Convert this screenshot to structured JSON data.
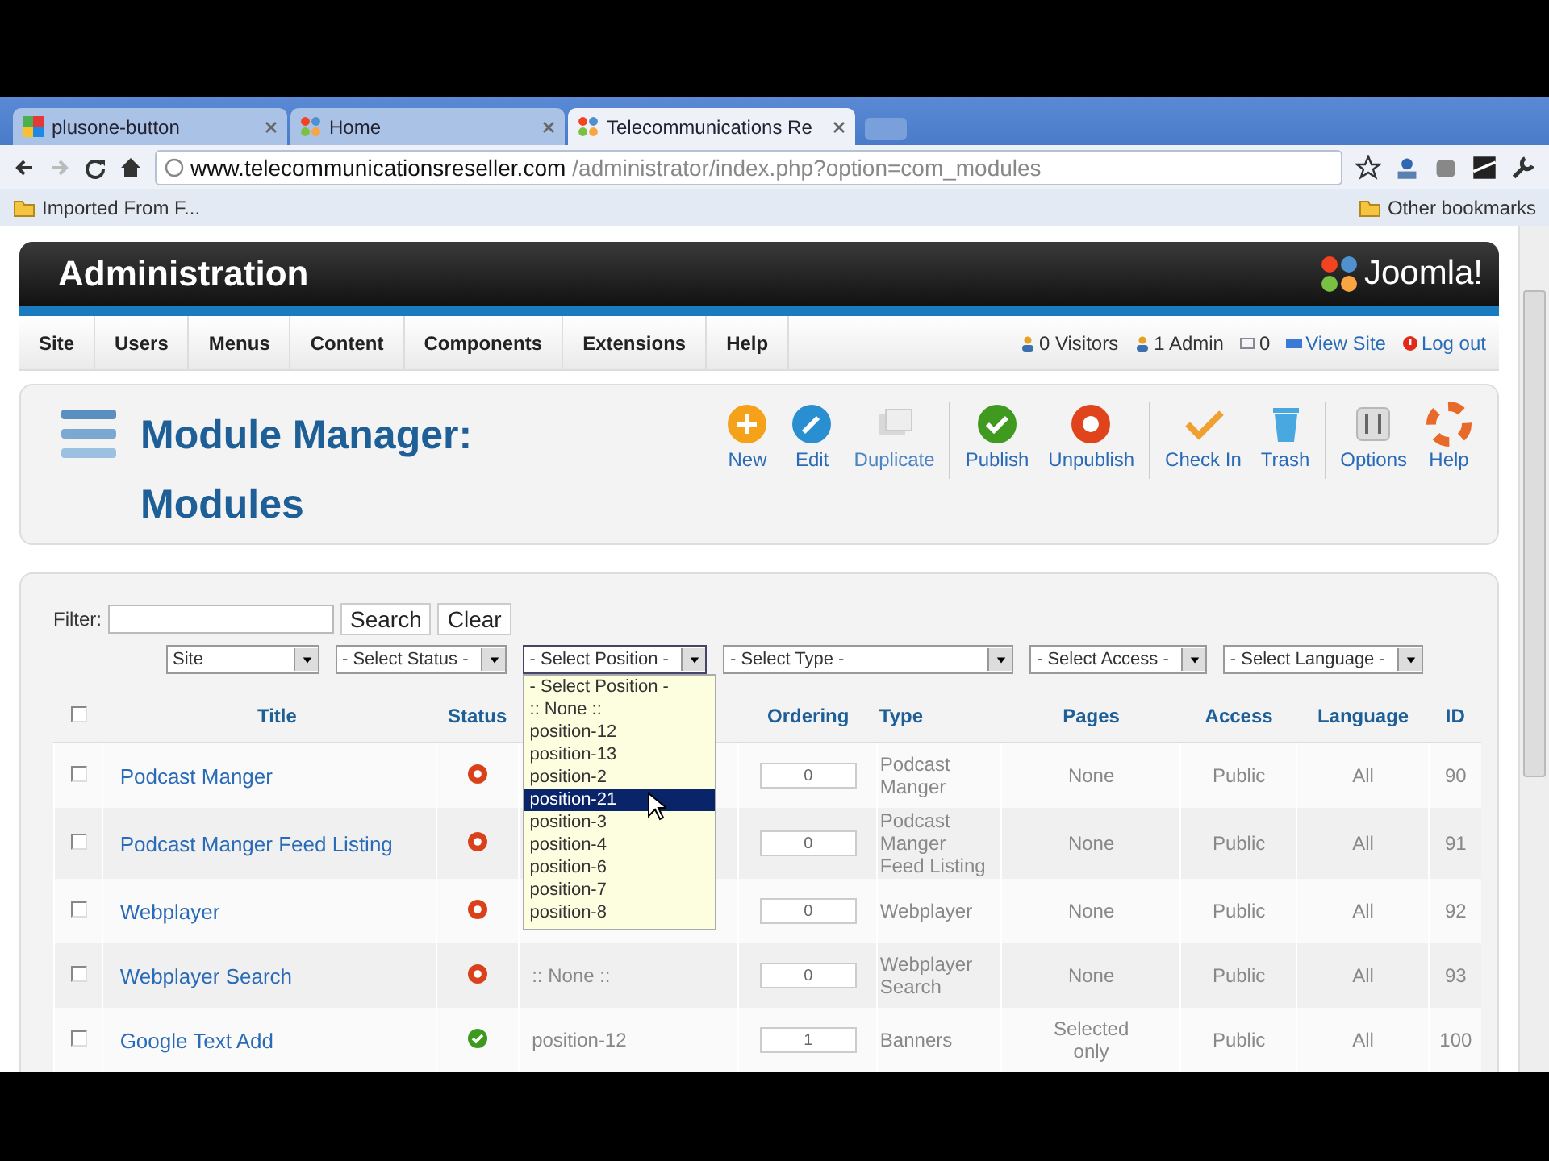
{
  "browser": {
    "tabs": [
      {
        "label": "plusone-button",
        "selected": false
      },
      {
        "label": "Home",
        "selected": false
      },
      {
        "label": "Telecommunications Re",
        "selected": true
      }
    ],
    "address": {
      "host": "www.telecommunicationsreseller.com",
      "path": "/administrator/index.php?option=com_modules"
    },
    "bookmarks": [
      "Imported From F..."
    ],
    "other_bookmarks": "Other bookmarks"
  },
  "header": {
    "title": "Administration",
    "logo": "Joomla!"
  },
  "menu": [
    "Site",
    "Users",
    "Menus",
    "Content",
    "Components",
    "Extensions",
    "Help"
  ],
  "status": [
    {
      "kind": "visitors",
      "label": "0 Visitors"
    },
    {
      "kind": "admin",
      "label": "1 Admin"
    },
    {
      "kind": "mail",
      "label": "0"
    },
    {
      "kind": "site",
      "label": "View Site"
    },
    {
      "kind": "logout",
      "label": "Log out"
    }
  ],
  "page_title": "Module Manager: Modules",
  "toolbar": [
    {
      "kind": "new",
      "label": "New",
      "divider_before": false
    },
    {
      "kind": "edit",
      "label": "Edit",
      "divider_before": false
    },
    {
      "kind": "duplicate",
      "label": "Duplicate",
      "divider_before": false
    },
    {
      "kind": "publish",
      "label": "Publish",
      "divider_before": true
    },
    {
      "kind": "unpublish",
      "label": "Unpublish",
      "divider_before": false
    },
    {
      "kind": "checkin",
      "label": "Check In",
      "divider_before": true
    },
    {
      "kind": "trash",
      "label": "Trash",
      "divider_before": false
    },
    {
      "kind": "options",
      "label": "Options",
      "divider_before": true
    },
    {
      "kind": "help",
      "label": "Help",
      "divider_before": false
    }
  ],
  "filter": {
    "label": "Filter:",
    "search": "Search",
    "clear": "Clear"
  },
  "selects": [
    {
      "label": "Site",
      "expanded": false
    },
    {
      "label": "- Select Status -",
      "expanded": false
    },
    {
      "label": "- Select Position -",
      "expanded": true
    },
    {
      "label": "- Select Type -",
      "expanded": false
    },
    {
      "label": "- Select Access -",
      "expanded": false
    },
    {
      "label": "- Select Language -",
      "expanded": false
    }
  ],
  "position_options": [
    {
      "label": "- Select Position -",
      "selected": false
    },
    {
      "label": ":: None ::",
      "selected": false
    },
    {
      "label": "position-12",
      "selected": false
    },
    {
      "label": "position-13",
      "selected": false
    },
    {
      "label": "position-2",
      "selected": false
    },
    {
      "label": "position-21",
      "selected": true
    },
    {
      "label": "position-3",
      "selected": false
    },
    {
      "label": "position-4",
      "selected": false
    },
    {
      "label": "position-6",
      "selected": false
    },
    {
      "label": "position-7",
      "selected": false
    },
    {
      "label": "position-8",
      "selected": false
    }
  ],
  "table": {
    "select_all_checked": false,
    "columns": [
      "Title",
      "Status",
      "Ordering",
      "Type",
      "Pages",
      "Access",
      "Language",
      "ID"
    ],
    "rows": [
      {
        "checked": false,
        "title": "Podcast Manger",
        "published": false,
        "ordering": "0",
        "type": "Podcast Manger",
        "pages": "None",
        "access": "Public",
        "language": "All",
        "id": "90"
      },
      {
        "checked": false,
        "title": "Podcast Manger Feed Listing",
        "published": false,
        "ordering": "0",
        "type": "Podcast Manger Feed Listing",
        "pages": "None",
        "access": "Public",
        "language": "All",
        "id": "91"
      },
      {
        "checked": false,
        "title": "Webplayer",
        "published": false,
        "ordering": "0",
        "type": "Webplayer",
        "pages": "None",
        "access": "Public",
        "language": "All",
        "id": "92"
      },
      {
        "checked": false,
        "title": "Webplayer Search",
        "published": false,
        "position": ":: None ::",
        "ordering": "0",
        "type": "Webplayer Search",
        "pages": "None",
        "access": "Public",
        "language": "All",
        "id": "93"
      },
      {
        "checked": false,
        "title": "Google Text Add",
        "published": true,
        "position": "position-12",
        "ordering": "1",
        "type": "Banners",
        "pages": "Selected only",
        "access": "Public",
        "language": "All",
        "id": "100"
      }
    ]
  }
}
